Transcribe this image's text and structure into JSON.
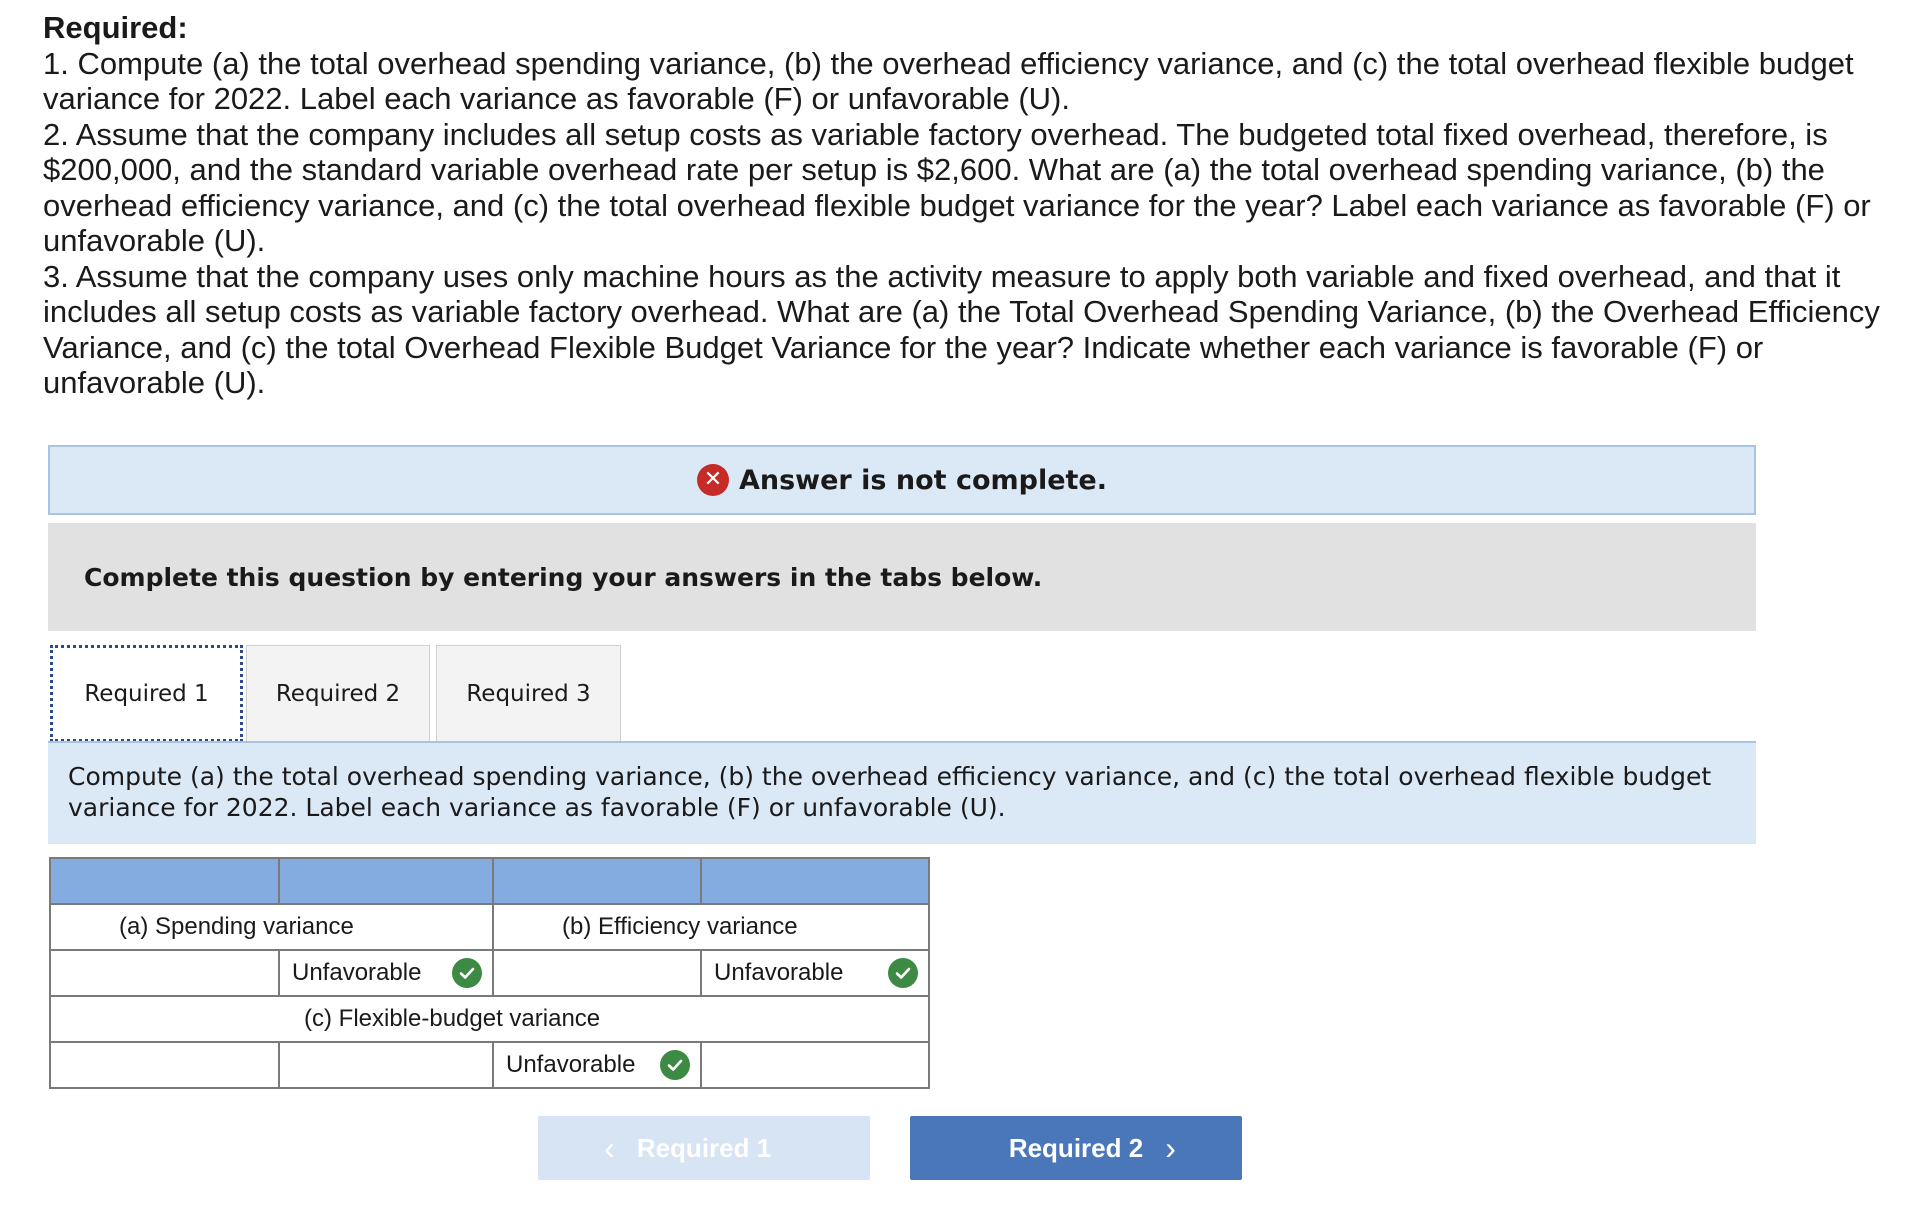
{
  "required": {
    "title": "Required:",
    "items": [
      "1. Compute (a) the total overhead spending variance, (b) the overhead efficiency variance, and (c) the total overhead flexible budget variance for 2022. Label each variance as favorable (F) or unfavorable (U).",
      "2. Assume that the company includes all setup costs as variable factory overhead. The budgeted total fixed overhead, therefore, is $200,000, and the standard variable overhead rate per setup is $2,600. What are (a) the total overhead spending variance, (b) the overhead efficiency variance, and (c) the total overhead flexible budget variance for the year? Label each variance as favorable (F) or unfavorable (U).",
      "3. Assume that the company uses only machine hours as the activity measure to apply both variable and fixed overhead, and that it includes all setup costs as variable factory overhead. What are (a) the Total Overhead Spending Variance, (b) the Overhead Efficiency Variance, and (c) the total Overhead Flexible Budget Variance for the year? Indicate whether each variance is favorable (F) or unfavorable (U)."
    ]
  },
  "status": {
    "text": "Answer is not complete.",
    "icon": "x-circle-icon",
    "color": "#c62b28"
  },
  "instruction": "Complete this question by entering your answers in the tabs below.",
  "tabs": [
    {
      "label": "Required 1",
      "active": true
    },
    {
      "label": "Required 2",
      "active": false
    },
    {
      "label": "Required 3",
      "active": false
    }
  ],
  "prompt": "Compute (a) the total overhead spending variance, (b) the overhead efficiency variance, and (c) the total overhead flexible budget variance for 2022. Label each variance as favorable (F) or unfavorable (U).",
  "table": {
    "spending_label": "(a) Spending variance",
    "efficiency_label": "(b) Efficiency variance",
    "flexible_label": "(c) Flexible-budget variance",
    "spending_amount": "",
    "spending_type": "Unfavorable",
    "efficiency_amount": "",
    "efficiency_type": "Unfavorable",
    "flexible_amount": "",
    "flexible_type": "Unfavorable"
  },
  "nav": {
    "prev_label": "Required 1",
    "next_label": "Required 2"
  },
  "colors": {
    "header_blue": "#84ace0",
    "check_green": "#3d8a44",
    "next_button": "#4a77ba"
  }
}
